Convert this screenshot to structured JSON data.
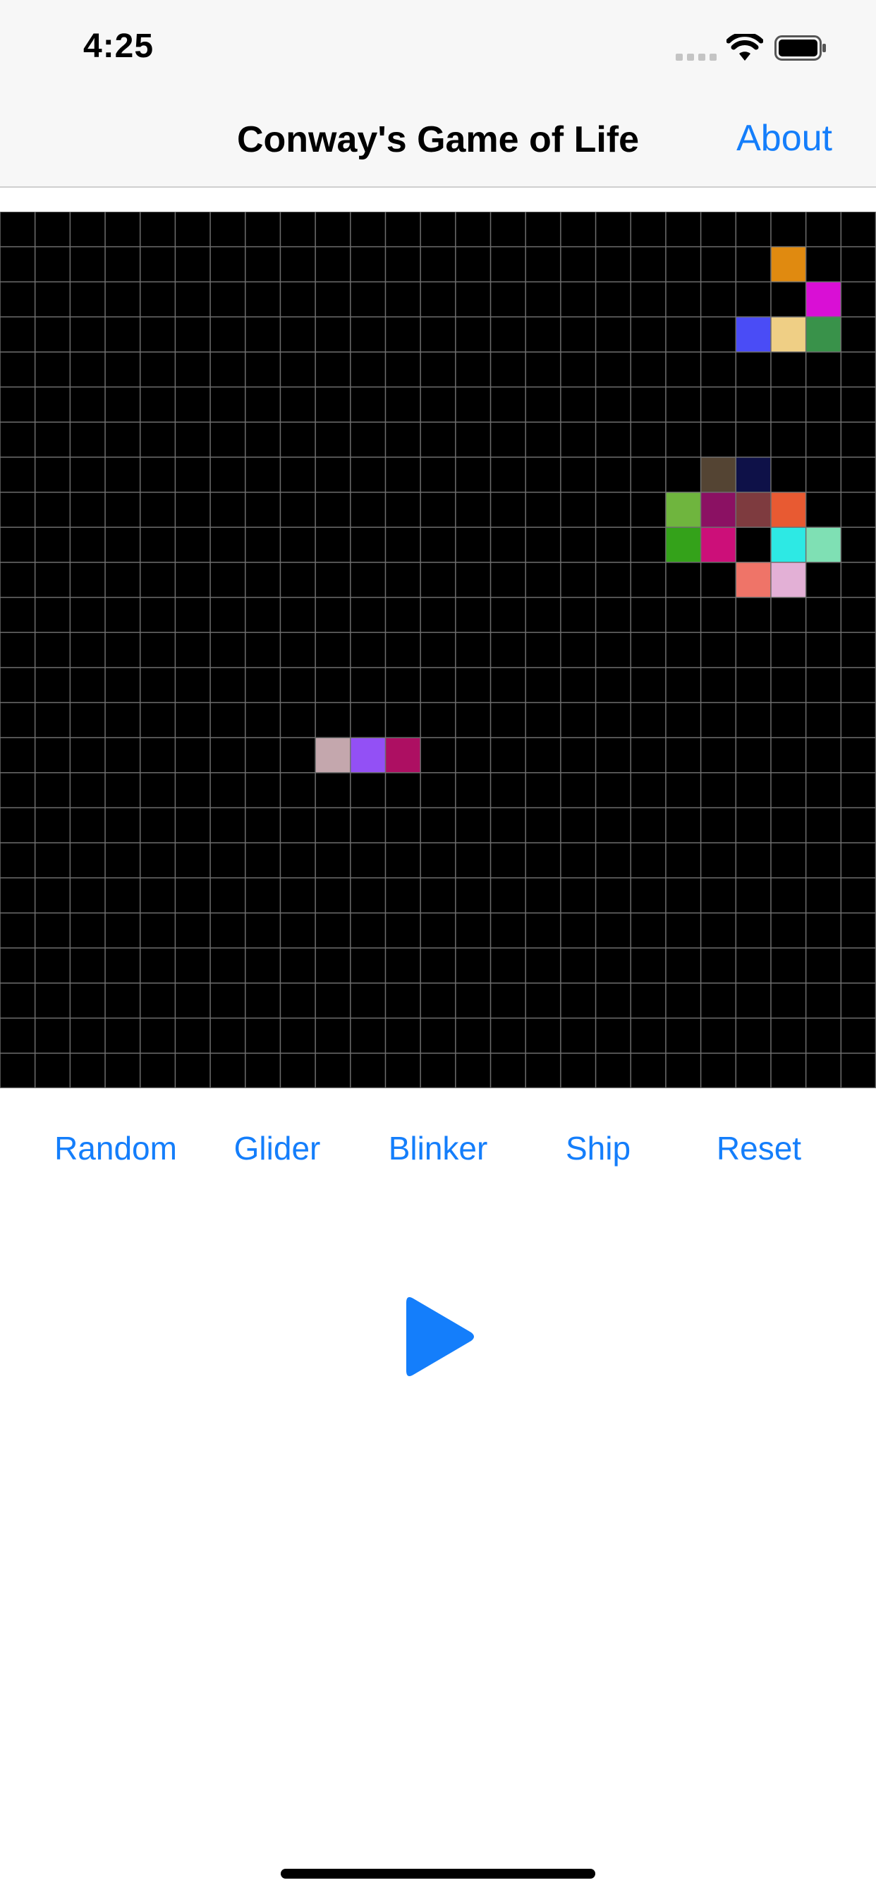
{
  "status_bar": {
    "time": "4:25",
    "icons": [
      "cellular-signal-icon",
      "wifi-icon",
      "battery-icon"
    ]
  },
  "nav": {
    "title": "Conway's Game of Life",
    "about_label": "About"
  },
  "board": {
    "columns": 25,
    "rows": 25,
    "background": "#000000",
    "grid_color": "#6e6e6e",
    "live_cells": [
      {
        "row": 1,
        "col": 22,
        "color": "#e08a10"
      },
      {
        "row": 2,
        "col": 23,
        "color": "#d90fd5"
      },
      {
        "row": 3,
        "col": 21,
        "color": "#4a4cf6"
      },
      {
        "row": 3,
        "col": 22,
        "color": "#efcf85"
      },
      {
        "row": 3,
        "col": 23,
        "color": "#39924a"
      },
      {
        "row": 7,
        "col": 20,
        "color": "#544433"
      },
      {
        "row": 7,
        "col": 21,
        "color": "#0e1148"
      },
      {
        "row": 8,
        "col": 19,
        "color": "#6fb53e"
      },
      {
        "row": 8,
        "col": 20,
        "color": "#8b1163"
      },
      {
        "row": 8,
        "col": 21,
        "color": "#7e3b3f"
      },
      {
        "row": 8,
        "col": 22,
        "color": "#e85a32"
      },
      {
        "row": 9,
        "col": 19,
        "color": "#34a21a"
      },
      {
        "row": 9,
        "col": 20,
        "color": "#cc0f79"
      },
      {
        "row": 9,
        "col": 22,
        "color": "#2de9e4"
      },
      {
        "row": 9,
        "col": 23,
        "color": "#7fe0b4"
      },
      {
        "row": 10,
        "col": 21,
        "color": "#ef7468"
      },
      {
        "row": 10,
        "col": 22,
        "color": "#e3b0d6"
      },
      {
        "row": 15,
        "col": 9,
        "color": "#c4a7ad"
      },
      {
        "row": 15,
        "col": 10,
        "color": "#9350f5"
      },
      {
        "row": 15,
        "col": 11,
        "color": "#ad0f62"
      }
    ]
  },
  "controls": {
    "random_label": "Random",
    "glider_label": "Glider",
    "blinker_label": "Blinker",
    "ship_label": "Ship",
    "reset_label": "Reset"
  },
  "play_button": {
    "icon": "play-icon",
    "color": "#147efb"
  },
  "colors": {
    "accent": "#147efb",
    "bar_background": "#f7f7f7"
  }
}
